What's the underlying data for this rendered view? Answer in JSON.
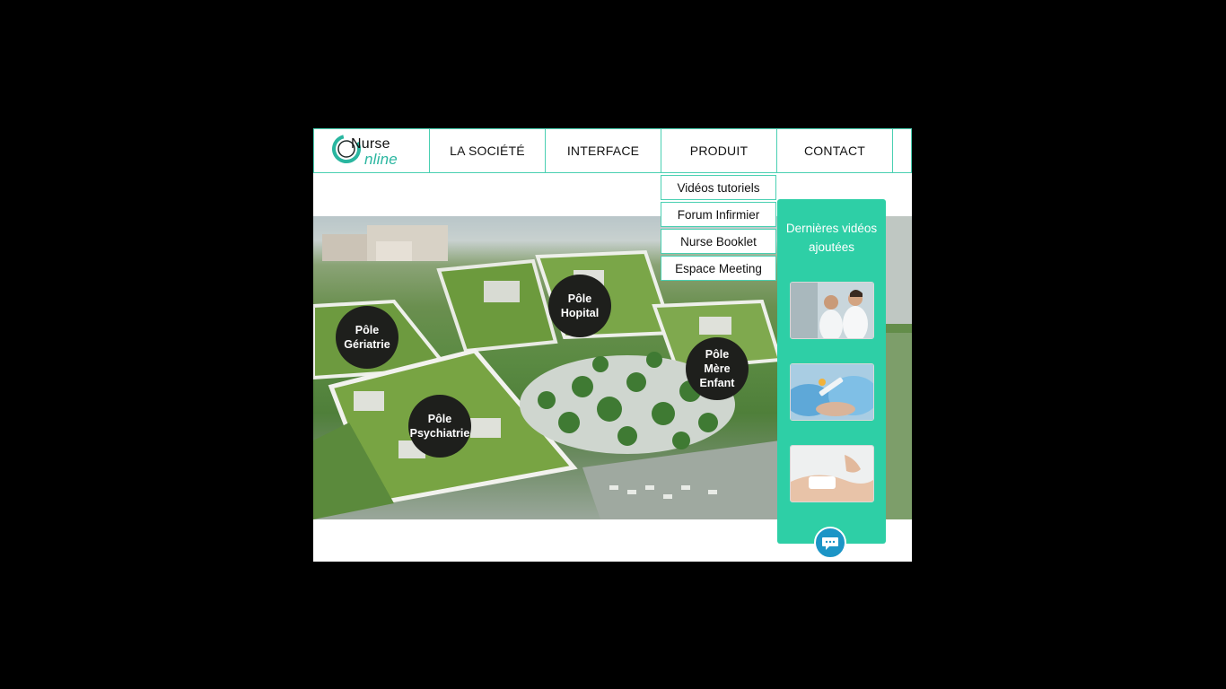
{
  "brand": {
    "logo_line1": "Nurse",
    "logo_line2": "nline",
    "accent": "#2ecfa6"
  },
  "nav": {
    "items": [
      {
        "label": "LA SOCIÉTÉ"
      },
      {
        "label": "INTERFACE"
      },
      {
        "label": "PRODUIT"
      },
      {
        "label": "CONTACT"
      }
    ]
  },
  "dropdown": {
    "items": [
      {
        "label": "Vidéos tutoriels"
      },
      {
        "label": "Forum Infirmier"
      },
      {
        "label": "Nurse Booklet"
      },
      {
        "label": "Espace Meeting"
      }
    ]
  },
  "poles": [
    {
      "label": "Pôle\nHopital"
    },
    {
      "label": "Pôle\nGériatrie"
    },
    {
      "label": "Pôle\nMère\nEnfant"
    },
    {
      "label": "Pôle\nPsychiatrie"
    }
  ],
  "panel": {
    "title": "Dernières vidéos ajoutées",
    "thumbnails": [
      "nurses-lab-thumbnail",
      "injection-thumbnail",
      "bandage-thumbnail"
    ]
  },
  "chat": {
    "icon": "chat-bubble-icon",
    "color": "#1c95c6"
  }
}
